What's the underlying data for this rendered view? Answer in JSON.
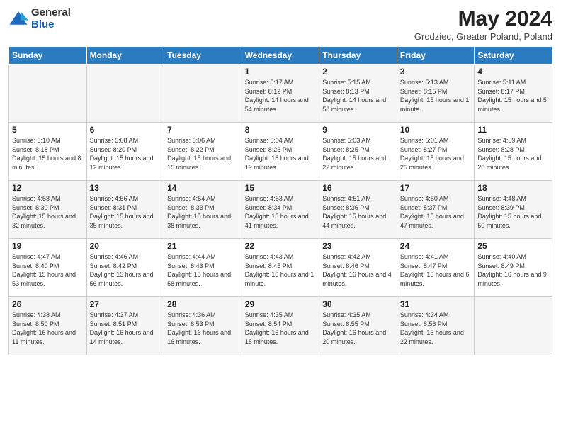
{
  "logo": {
    "general": "General",
    "blue": "Blue"
  },
  "title": "May 2024",
  "subtitle": "Grodziec, Greater Poland, Poland",
  "days_of_week": [
    "Sunday",
    "Monday",
    "Tuesday",
    "Wednesday",
    "Thursday",
    "Friday",
    "Saturday"
  ],
  "weeks": [
    [
      {
        "day": "",
        "info": ""
      },
      {
        "day": "",
        "info": ""
      },
      {
        "day": "",
        "info": ""
      },
      {
        "day": "1",
        "info": "Sunrise: 5:17 AM\nSunset: 8:12 PM\nDaylight: 14 hours and 54 minutes."
      },
      {
        "day": "2",
        "info": "Sunrise: 5:15 AM\nSunset: 8:13 PM\nDaylight: 14 hours and 58 minutes."
      },
      {
        "day": "3",
        "info": "Sunrise: 5:13 AM\nSunset: 8:15 PM\nDaylight: 15 hours and 1 minute."
      },
      {
        "day": "4",
        "info": "Sunrise: 5:11 AM\nSunset: 8:17 PM\nDaylight: 15 hours and 5 minutes."
      }
    ],
    [
      {
        "day": "5",
        "info": "Sunrise: 5:10 AM\nSunset: 8:18 PM\nDaylight: 15 hours and 8 minutes."
      },
      {
        "day": "6",
        "info": "Sunrise: 5:08 AM\nSunset: 8:20 PM\nDaylight: 15 hours and 12 minutes."
      },
      {
        "day": "7",
        "info": "Sunrise: 5:06 AM\nSunset: 8:22 PM\nDaylight: 15 hours and 15 minutes."
      },
      {
        "day": "8",
        "info": "Sunrise: 5:04 AM\nSunset: 8:23 PM\nDaylight: 15 hours and 19 minutes."
      },
      {
        "day": "9",
        "info": "Sunrise: 5:03 AM\nSunset: 8:25 PM\nDaylight: 15 hours and 22 minutes."
      },
      {
        "day": "10",
        "info": "Sunrise: 5:01 AM\nSunset: 8:27 PM\nDaylight: 15 hours and 25 minutes."
      },
      {
        "day": "11",
        "info": "Sunrise: 4:59 AM\nSunset: 8:28 PM\nDaylight: 15 hours and 28 minutes."
      }
    ],
    [
      {
        "day": "12",
        "info": "Sunrise: 4:58 AM\nSunset: 8:30 PM\nDaylight: 15 hours and 32 minutes."
      },
      {
        "day": "13",
        "info": "Sunrise: 4:56 AM\nSunset: 8:31 PM\nDaylight: 15 hours and 35 minutes."
      },
      {
        "day": "14",
        "info": "Sunrise: 4:54 AM\nSunset: 8:33 PM\nDaylight: 15 hours and 38 minutes."
      },
      {
        "day": "15",
        "info": "Sunrise: 4:53 AM\nSunset: 8:34 PM\nDaylight: 15 hours and 41 minutes."
      },
      {
        "day": "16",
        "info": "Sunrise: 4:51 AM\nSunset: 8:36 PM\nDaylight: 15 hours and 44 minutes."
      },
      {
        "day": "17",
        "info": "Sunrise: 4:50 AM\nSunset: 8:37 PM\nDaylight: 15 hours and 47 minutes."
      },
      {
        "day": "18",
        "info": "Sunrise: 4:48 AM\nSunset: 8:39 PM\nDaylight: 15 hours and 50 minutes."
      }
    ],
    [
      {
        "day": "19",
        "info": "Sunrise: 4:47 AM\nSunset: 8:40 PM\nDaylight: 15 hours and 53 minutes."
      },
      {
        "day": "20",
        "info": "Sunrise: 4:46 AM\nSunset: 8:42 PM\nDaylight: 15 hours and 56 minutes."
      },
      {
        "day": "21",
        "info": "Sunrise: 4:44 AM\nSunset: 8:43 PM\nDaylight: 15 hours and 58 minutes."
      },
      {
        "day": "22",
        "info": "Sunrise: 4:43 AM\nSunset: 8:45 PM\nDaylight: 16 hours and 1 minute."
      },
      {
        "day": "23",
        "info": "Sunrise: 4:42 AM\nSunset: 8:46 PM\nDaylight: 16 hours and 4 minutes."
      },
      {
        "day": "24",
        "info": "Sunrise: 4:41 AM\nSunset: 8:47 PM\nDaylight: 16 hours and 6 minutes."
      },
      {
        "day": "25",
        "info": "Sunrise: 4:40 AM\nSunset: 8:49 PM\nDaylight: 16 hours and 9 minutes."
      }
    ],
    [
      {
        "day": "26",
        "info": "Sunrise: 4:38 AM\nSunset: 8:50 PM\nDaylight: 16 hours and 11 minutes."
      },
      {
        "day": "27",
        "info": "Sunrise: 4:37 AM\nSunset: 8:51 PM\nDaylight: 16 hours and 14 minutes."
      },
      {
        "day": "28",
        "info": "Sunrise: 4:36 AM\nSunset: 8:53 PM\nDaylight: 16 hours and 16 minutes."
      },
      {
        "day": "29",
        "info": "Sunrise: 4:35 AM\nSunset: 8:54 PM\nDaylight: 16 hours and 18 minutes."
      },
      {
        "day": "30",
        "info": "Sunrise: 4:35 AM\nSunset: 8:55 PM\nDaylight: 16 hours and 20 minutes."
      },
      {
        "day": "31",
        "info": "Sunrise: 4:34 AM\nSunset: 8:56 PM\nDaylight: 16 hours and 22 minutes."
      },
      {
        "day": "",
        "info": ""
      }
    ]
  ]
}
